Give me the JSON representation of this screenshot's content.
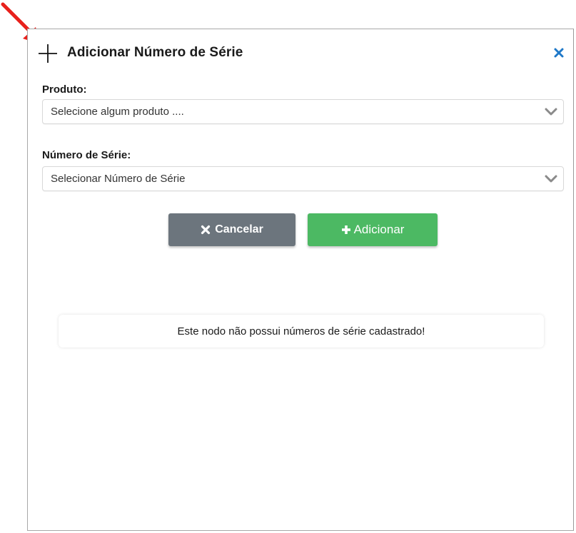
{
  "modal": {
    "title": "Adicionar Número de Série",
    "header_icon": "plus-icon",
    "close_icon": "close-icon",
    "accent_color": "#1f78c8"
  },
  "form": {
    "product": {
      "label": "Produto:",
      "value": "Selecione algum produto ...."
    },
    "serial": {
      "label": "Número de Série:",
      "value": "Selecionar Número de Série"
    }
  },
  "buttons": {
    "cancel": {
      "label": "Cancelar",
      "icon": "times-icon",
      "color": "#6c757d"
    },
    "add": {
      "label": "Adicionar",
      "icon": "plus-icon",
      "color": "#4cb963"
    }
  },
  "message": {
    "text": "Este nodo não possui números de série cadastrado!"
  },
  "annotation": {
    "icon": "red-arrow-icon",
    "color": "#e8211c"
  }
}
